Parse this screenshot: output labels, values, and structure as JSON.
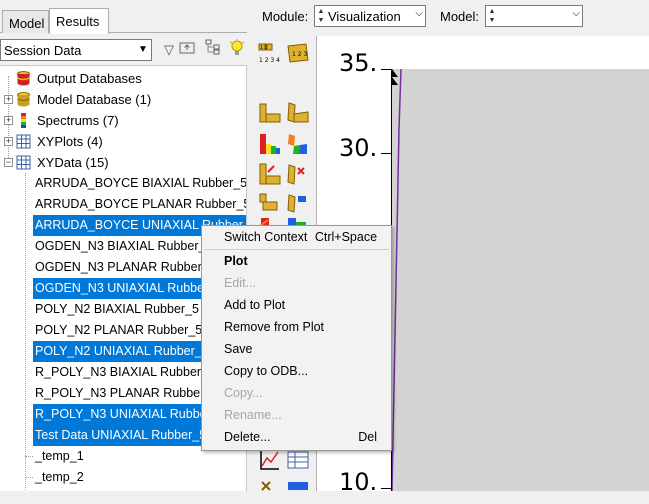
{
  "tabs": {
    "model": "Model",
    "results": "Results"
  },
  "session_select": {
    "value": "Session Data"
  },
  "tree": {
    "output_databases": "Output Databases",
    "model_database": "Model Database (1)",
    "spectrums": "Spectrums (7)",
    "xyplots": "XYPlots (4)",
    "xydata": "XYData (15)",
    "items": [
      {
        "label": "ARRUDA_BOYCE BIAXIAL Rubber_5",
        "selected": false
      },
      {
        "label": "ARRUDA_BOYCE PLANAR Rubber_5",
        "selected": false
      },
      {
        "label": "ARRUDA_BOYCE UNIAXIAL Rubber_5",
        "selected": true
      },
      {
        "label": "OGDEN_N3 BIAXIAL Rubber_5",
        "selected": false
      },
      {
        "label": "OGDEN_N3 PLANAR Rubber_5",
        "selected": false
      },
      {
        "label": "OGDEN_N3 UNIAXIAL Rubber_5",
        "selected": true
      },
      {
        "label": "POLY_N2 BIAXIAL Rubber_5",
        "selected": false
      },
      {
        "label": "POLY_N2 PLANAR Rubber_5",
        "selected": false
      },
      {
        "label": "POLY_N2 UNIAXIAL Rubber_5",
        "selected": true
      },
      {
        "label": "R_POLY_N3 BIAXIAL Rubber_5",
        "selected": false
      },
      {
        "label": "R_POLY_N3 PLANAR Rubber_5",
        "selected": false
      },
      {
        "label": "R_POLY_N3 UNIAXIAL Rubber_5",
        "selected": true
      },
      {
        "label": "Test Data UNIAXIAL Rubber_5",
        "selected": true
      },
      {
        "label": "_temp_1",
        "selected": false
      },
      {
        "label": "_temp_2",
        "selected": false
      }
    ]
  },
  "toolbar": {
    "module_label": "Module:",
    "module_value": "Visualization",
    "model_label": "Model:",
    "model_value": ""
  },
  "viewport": {
    "ytick_35": "35.",
    "ytick_30": "30.",
    "ytick_10": "10."
  },
  "context_menu": {
    "switch_context": "Switch Context",
    "switch_context_shortcut": "Ctrl+Space",
    "plot": "Plot",
    "edit": "Edit...",
    "add_to_plot": "Add to Plot",
    "remove_from_plot": "Remove from Plot",
    "save": "Save",
    "copy_to_odb": "Copy to ODB...",
    "copy": "Copy...",
    "rename": "Rename...",
    "delete": "Delete...",
    "delete_shortcut": "Del"
  },
  "colors": {
    "selection": "#0078d7",
    "plot_background": "#d3d3d3",
    "curve": "#7030a0"
  }
}
